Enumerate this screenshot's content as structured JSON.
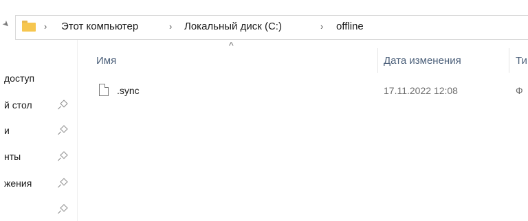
{
  "breadcrumb": {
    "items": [
      "Этот компьютер",
      "Локальный диск (C:)",
      "offline"
    ],
    "separator": "›"
  },
  "sidebar": {
    "items": [
      {
        "label": "доступ",
        "pinned": false
      },
      {
        "label": "й стол",
        "pinned": true
      },
      {
        "label": "и",
        "pinned": true
      },
      {
        "label": "нты",
        "pinned": true
      },
      {
        "label": "жения",
        "pinned": true
      },
      {
        "label": "",
        "pinned": true
      }
    ]
  },
  "columns": {
    "name": "Имя",
    "date_modified": "Дата изменения",
    "type": "Ти"
  },
  "files": [
    {
      "name": ".sync",
      "date": "17.11.2022 12:08",
      "type": "Ф"
    }
  ],
  "icons": {
    "folder": "folder-icon",
    "file": "file-icon",
    "pin": "pin-icon",
    "sort": "sort-ascending-icon"
  }
}
